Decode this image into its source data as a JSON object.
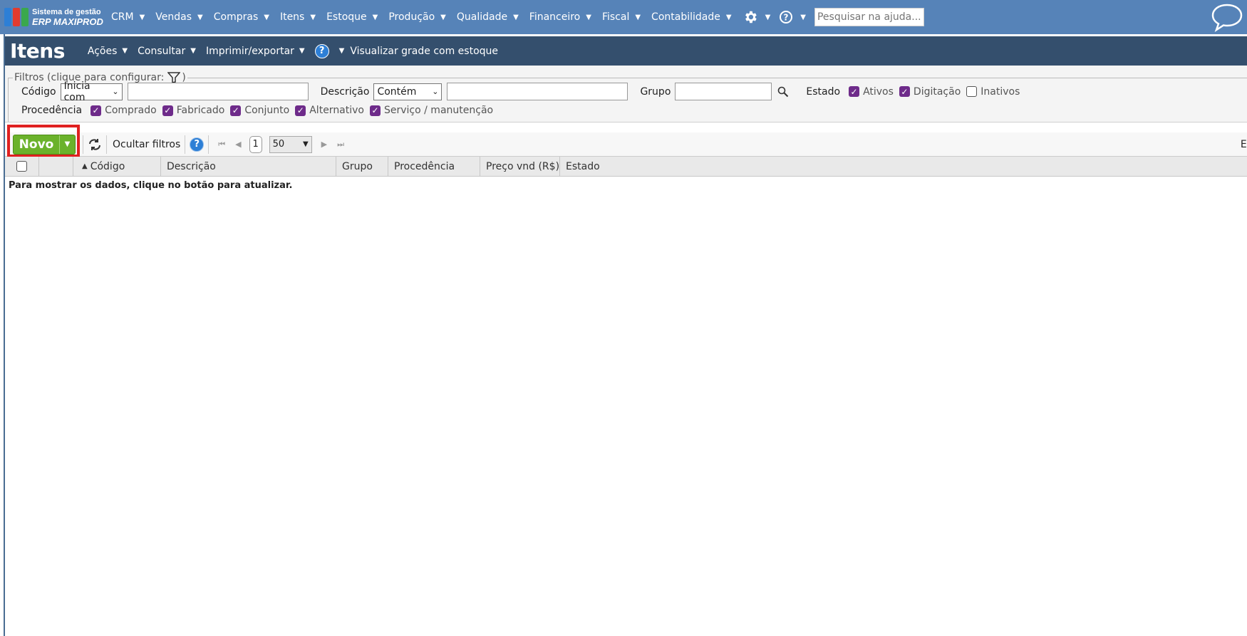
{
  "app": {
    "logo_line1": "Sistema de gestão",
    "logo_line2": "ERP MAXIPROD",
    "logo_colors": [
      "#2d7fd6",
      "#e23b2e",
      "#f2c22e",
      "#3aa84c"
    ]
  },
  "topnav": {
    "items": [
      {
        "label": "CRM"
      },
      {
        "label": "Vendas"
      },
      {
        "label": "Compras"
      },
      {
        "label": "Itens"
      },
      {
        "label": "Estoque"
      },
      {
        "label": "Produção"
      },
      {
        "label": "Qualidade"
      },
      {
        "label": "Financeiro"
      },
      {
        "label": "Fiscal"
      },
      {
        "label": "Contabilidade"
      }
    ],
    "settings_icon": "gear-icon",
    "help_icon": "question-circle-icon",
    "search_placeholder": "Pesquisar na ajuda...",
    "chat_icon": "chat-bubble-icon"
  },
  "page": {
    "title": "Itens",
    "menu": {
      "acoes": "Ações",
      "consultar": "Consultar",
      "imprimir": "Imprimir/exportar",
      "help": "?",
      "grade": "Visualizar grade com estoque"
    }
  },
  "filters": {
    "legend": "Filtros (clique para configurar:",
    "legend_close": ")",
    "codigo_label": "Código",
    "codigo_mode": "Inicia com",
    "codigo_value": "",
    "descricao_label": "Descrição",
    "descricao_mode": "Contém",
    "descricao_value": "",
    "grupo_label": "Grupo",
    "grupo_value": "",
    "estado_label": "Estado",
    "estado_options": [
      {
        "label": "Ativos",
        "checked": true
      },
      {
        "label": "Digitação",
        "checked": true
      },
      {
        "label": "Inativos",
        "checked": false
      }
    ],
    "procedencia_label": "Procedência",
    "procedencia_options": [
      {
        "label": "Comprado",
        "checked": true
      },
      {
        "label": "Fabricado",
        "checked": true
      },
      {
        "label": "Conjunto",
        "checked": true
      },
      {
        "label": "Alternativo",
        "checked": true
      },
      {
        "label": "Serviço / manutenção",
        "checked": true
      }
    ]
  },
  "toolbar": {
    "new_label": "Novo",
    "hide_filters": "Ocultar filtros",
    "help": "?",
    "page": "1",
    "per_page": "50",
    "export_partial": "Ex"
  },
  "grid": {
    "columns": [
      "Código",
      "Descrição",
      "Grupo",
      "Procedência",
      "Preço vnd (R$)",
      "Estado"
    ],
    "sorted_column": "Código",
    "empty_message": "Para mostrar os dados, clique no botão para atualizar."
  },
  "colors": {
    "topbar": "#5683b8",
    "titlebar": "#344f6d",
    "new_button": "#6bb22b",
    "checkbox": "#6e2b8a",
    "highlight": "#e02020"
  }
}
